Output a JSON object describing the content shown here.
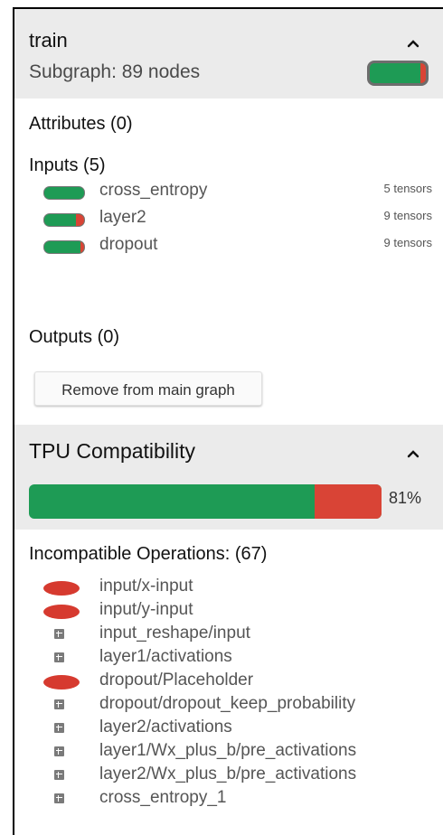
{
  "node_panel": {
    "title": "train",
    "subtitle": "Subgraph: 89 nodes",
    "attributes_label": "Attributes (0)",
    "inputs_label": "Inputs (5)",
    "inputs": [
      {
        "name": "cross_entropy",
        "count": "5 tensors",
        "incompatible_fraction": 0.0
      },
      {
        "name": "layer2",
        "count": "9 tensors",
        "incompatible_fraction": 0.2
      },
      {
        "name": "dropout",
        "count": "9 tensors",
        "incompatible_fraction": 0.1
      }
    ],
    "outputs_label": "Outputs (0)",
    "remove_button_label": "Remove from main graph",
    "subgraph_incompatible_fraction": 0.1
  },
  "tpu_panel": {
    "title": "TPU Compatibility",
    "compatibility_percent": 81,
    "compatibility_label": "81%",
    "incompatible_label": "Incompatible Operations: (67)",
    "operations": [
      {
        "name": "input/x-input",
        "icon": "placeholder-ellipse-icon"
      },
      {
        "name": "input/y-input",
        "icon": "placeholder-ellipse-icon"
      },
      {
        "name": "input_reshape/input",
        "icon": "summary-op-icon"
      },
      {
        "name": "layer1/activations",
        "icon": "summary-op-icon"
      },
      {
        "name": "dropout/Placeholder",
        "icon": "placeholder-ellipse-icon"
      },
      {
        "name": "dropout/dropout_keep_probability",
        "icon": "summary-op-icon"
      },
      {
        "name": "layer2/activations",
        "icon": "summary-op-icon"
      },
      {
        "name": "layer1/Wx_plus_b/pre_activations",
        "icon": "summary-op-icon"
      },
      {
        "name": "layer2/Wx_plus_b/pre_activations",
        "icon": "summary-op-icon"
      },
      {
        "name": "cross_entropy_1",
        "icon": "summary-op-icon"
      }
    ]
  },
  "colors": {
    "compatible": "#1e9b55",
    "incompatible": "#d94436",
    "header_bg": "#ebebeb"
  }
}
